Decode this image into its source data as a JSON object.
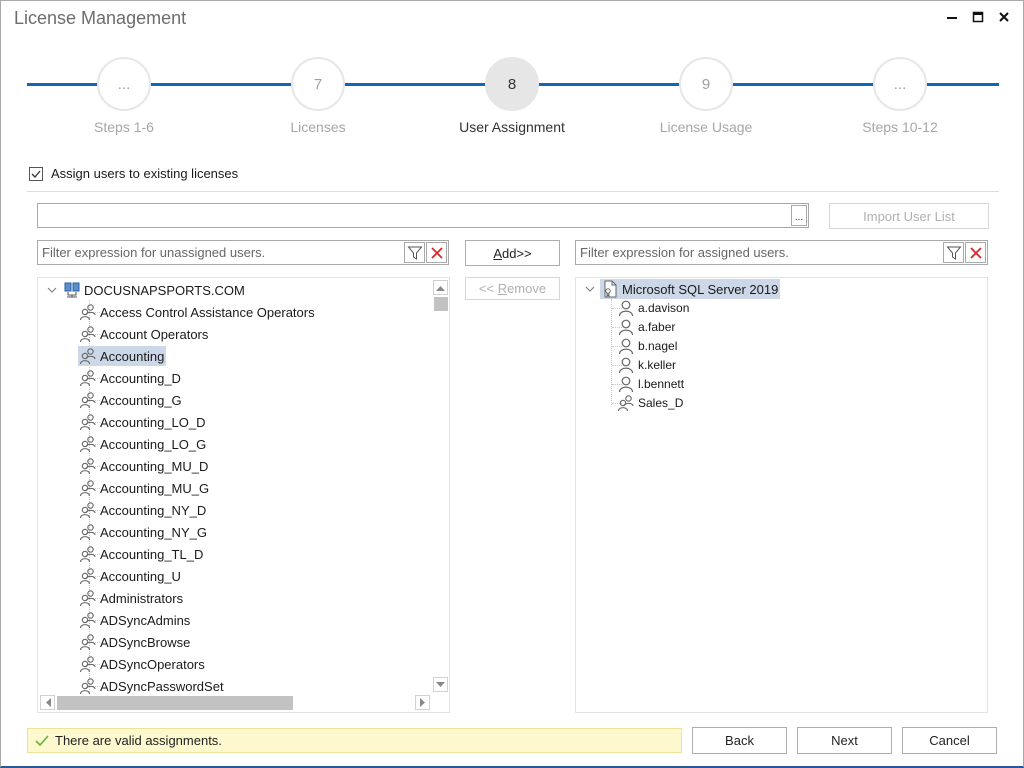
{
  "window": {
    "title": "License Management",
    "controls": {
      "minimize": "minimize-icon",
      "maximize": "maximize-icon",
      "close": "close-icon"
    }
  },
  "stepper": {
    "steps": [
      {
        "number": "...",
        "label": "Steps 1-6",
        "active": false
      },
      {
        "number": "7",
        "label": "Licenses",
        "active": false
      },
      {
        "number": "8",
        "label": "User Assignment",
        "active": true
      },
      {
        "number": "9",
        "label": "License Usage",
        "active": false
      },
      {
        "number": "...",
        "label": "Steps 10-12",
        "active": false
      }
    ]
  },
  "options": {
    "assign_existing_label": "Assign users to existing licenses",
    "assign_existing_checked": true
  },
  "import": {
    "path_value": "",
    "browse_label": "...",
    "import_button_label": "Import User List"
  },
  "unassigned": {
    "filter_placeholder": "Filter expression for unassigned users.",
    "root": {
      "label": "DOCUSNAPSPORTS.COM",
      "icon": "domain-icon",
      "expanded": true
    },
    "items": [
      {
        "label": "Access Control Assistance Operators",
        "icon": "group-icon"
      },
      {
        "label": "Account Operators",
        "icon": "group-icon"
      },
      {
        "label": "Accounting",
        "icon": "group-icon",
        "selected": true
      },
      {
        "label": "Accounting_D",
        "icon": "group-icon"
      },
      {
        "label": "Accounting_G",
        "icon": "group-icon"
      },
      {
        "label": "Accounting_LO_D",
        "icon": "group-icon"
      },
      {
        "label": "Accounting_LO_G",
        "icon": "group-icon"
      },
      {
        "label": "Accounting_MU_D",
        "icon": "group-icon"
      },
      {
        "label": "Accounting_MU_G",
        "icon": "group-icon"
      },
      {
        "label": "Accounting_NY_D",
        "icon": "group-icon"
      },
      {
        "label": "Accounting_NY_G",
        "icon": "group-icon"
      },
      {
        "label": "Accounting_TL_D",
        "icon": "group-icon"
      },
      {
        "label": "Accounting_U",
        "icon": "group-icon"
      },
      {
        "label": "Administrators",
        "icon": "group-icon"
      },
      {
        "label": "ADSyncAdmins",
        "icon": "group-icon"
      },
      {
        "label": "ADSyncBrowse",
        "icon": "group-icon"
      },
      {
        "label": "ADSyncOperators",
        "icon": "group-icon"
      },
      {
        "label": "ADSyncPasswordSet",
        "icon": "group-icon"
      }
    ]
  },
  "actions": {
    "add_label": "Add>>",
    "add_mnemonic": "A",
    "remove_label": "<< Remove",
    "remove_mnemonic": "R",
    "remove_enabled": false
  },
  "assigned": {
    "filter_placeholder": "Filter expression for assigned users.",
    "root": {
      "label": "Microsoft SQL Server 2019",
      "icon": "license-icon",
      "expanded": true,
      "selected": true
    },
    "items": [
      {
        "label": "a.davison",
        "icon": "user-icon"
      },
      {
        "label": "a.faber",
        "icon": "user-icon"
      },
      {
        "label": "b.nagel",
        "icon": "user-icon"
      },
      {
        "label": "k.keller",
        "icon": "user-icon"
      },
      {
        "label": "l.bennett",
        "icon": "user-icon"
      },
      {
        "label": "Sales_D",
        "icon": "group-icon"
      }
    ]
  },
  "status": {
    "icon": "checkmark-icon",
    "message": "There are valid assignments.",
    "color": "#fdf8cd"
  },
  "footer": {
    "back_label": "Back",
    "next_label": "Next",
    "cancel_label": "Cancel"
  },
  "colors": {
    "accent": "#1565b6",
    "selection": "#ccd8e8",
    "clear_red": "#d9262b",
    "check_green": "#6ab03c"
  }
}
